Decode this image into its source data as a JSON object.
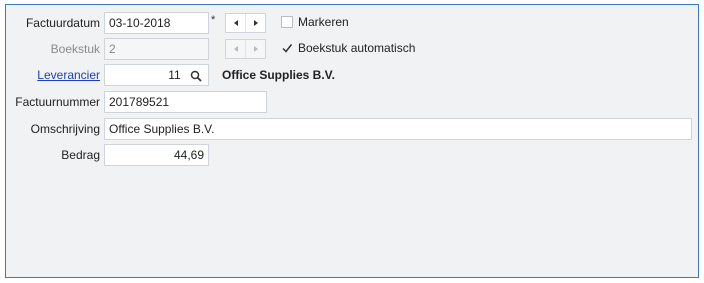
{
  "form": {
    "invoice_date_label": "Factuurdatum",
    "invoice_date_value": "03-10-2018",
    "required_marker": "*",
    "mark_label": "Markeren",
    "entry_label": "Boekstuk",
    "entry_value": "2",
    "auto_entry_label": "Boekstuk automatisch",
    "supplier_label": "Leverancier",
    "supplier_value": "11",
    "supplier_name": "Office Supplies B.V.",
    "invoice_number_label": "Factuurnummer",
    "invoice_number_value": "201789521",
    "description_label": "Omschrijving",
    "description_value": "Office Supplies B.V.",
    "amount_label": "Bedrag",
    "amount_value": "44,69"
  },
  "state": {
    "mark_checked": false,
    "auto_entry_checked": true
  },
  "colors": {
    "panel_border": "#3b78b8",
    "panel_background": "#f1f2f4",
    "link": "#1b3fbf"
  },
  "icons": {
    "prev": "chevron-left-icon",
    "next": "chevron-right-icon",
    "search": "search-icon",
    "check": "check-icon"
  }
}
